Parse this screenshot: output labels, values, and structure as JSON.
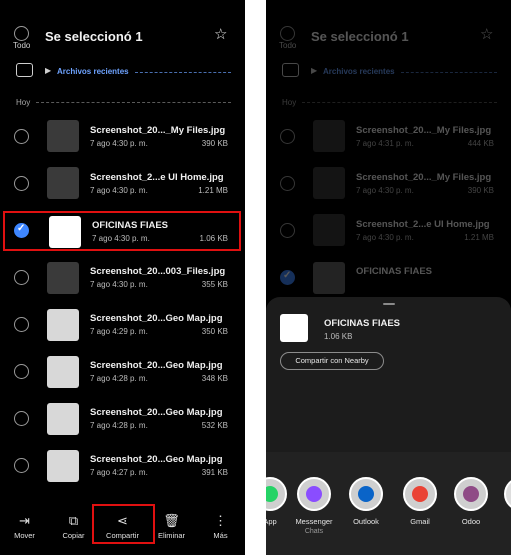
{
  "header": {
    "all_label": "Todo",
    "title": "Se seleccionó 1"
  },
  "breadcrumb": {
    "label": "Archivos recientes"
  },
  "section": {
    "label": "Hoy"
  },
  "left_files": [
    {
      "name": "Screenshot_20..._My Files.jpg",
      "date": "7 ago 4:30 p. m.",
      "size": "390 KB",
      "checked": false
    },
    {
      "name": "Screenshot_2...e UI Home.jpg",
      "date": "7 ago 4:30 p. m.",
      "size": "1.21 MB",
      "checked": false
    },
    {
      "name": "OFICINAS FIAES",
      "date": "7 ago 4:30 p. m.",
      "size": "1.06 KB",
      "checked": true
    },
    {
      "name": "Screenshot_20...003_Files.jpg",
      "date": "7 ago 4:30 p. m.",
      "size": "355 KB",
      "checked": false
    },
    {
      "name": "Screenshot_20...Geo Map.jpg",
      "date": "7 ago 4:29 p. m.",
      "size": "350 KB",
      "checked": false
    },
    {
      "name": "Screenshot_20...Geo Map.jpg",
      "date": "7 ago 4:28 p. m.",
      "size": "348 KB",
      "checked": false
    },
    {
      "name": "Screenshot_20...Geo Map.jpg",
      "date": "7 ago 4:28 p. m.",
      "size": "532 KB",
      "checked": false
    },
    {
      "name": "Screenshot_20...Geo Map.jpg",
      "date": "7 ago 4:27 p. m.",
      "size": "391 KB",
      "checked": false
    }
  ],
  "right_files": [
    {
      "name": "Screenshot_20..._My Files.jpg",
      "date": "7 ago 4:31 p. m.",
      "size": "444 KB"
    },
    {
      "name": "Screenshot_20..._My Files.jpg",
      "date": "7 ago 4:30 p. m.",
      "size": "390 KB"
    },
    {
      "name": "Screenshot_2...e UI Home.jpg",
      "date": "7 ago 4:30 p. m.",
      "size": "1.21 MB"
    },
    {
      "name": "OFICINAS FIAES",
      "date": "",
      "size": ""
    }
  ],
  "bottom_bar": {
    "move": "Mover",
    "copy": "Copiar",
    "share": "Compartir",
    "delete": "Eliminar",
    "more": "Más"
  },
  "share_sheet": {
    "file_name": "OFICINAS FIAES",
    "file_size": "1.06 KB",
    "nearby_label": "Compartir con Nearby",
    "apps": [
      {
        "label": "App",
        "sub": "",
        "color": "#25d366"
      },
      {
        "label": "Messenger",
        "sub": "Chats",
        "color": "#8a4dff"
      },
      {
        "label": "Outlook",
        "sub": "",
        "color": "#0a64c8"
      },
      {
        "label": "Gmail",
        "sub": "",
        "color": "#ea4335"
      },
      {
        "label": "Odoo",
        "sub": "",
        "color": "#8f4b86"
      }
    ]
  },
  "colors": {
    "accent": "#3e86ff",
    "highlight_box": "#e01010",
    "background": "#000000"
  }
}
